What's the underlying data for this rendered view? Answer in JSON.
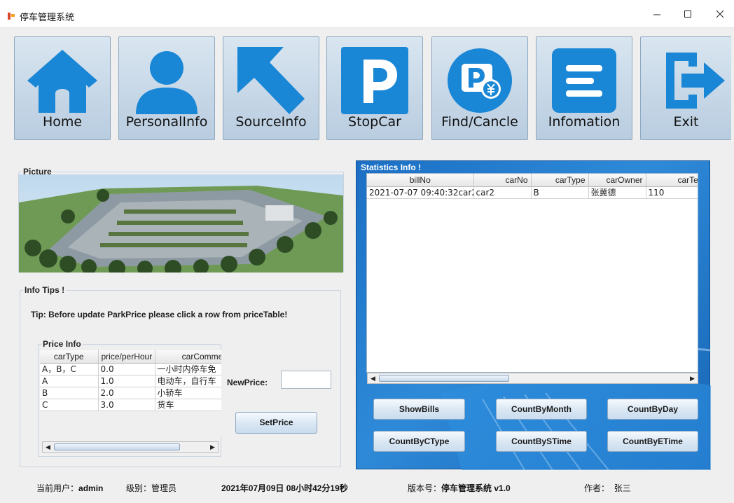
{
  "window": {
    "title": "停车管理系统"
  },
  "nav": [
    {
      "label": "Home",
      "icon": "home-icon"
    },
    {
      "label": "PersonalInfo",
      "icon": "person-icon"
    },
    {
      "label": "SourceInfo",
      "icon": "arrow-pointer-icon"
    },
    {
      "label": "StopCar",
      "icon": "parking-icon"
    },
    {
      "label": "Find/Cancle",
      "icon": "parking-payment-icon"
    },
    {
      "label": "Infomation",
      "icon": "list-icon"
    },
    {
      "label": "Exit",
      "icon": "exit-icon"
    }
  ],
  "picture": {
    "legend": "Picture"
  },
  "info_tips": {
    "legend": "Info Tips !",
    "tip": "Tip: Before update ParkPrice please click a row from priceTable!"
  },
  "price_info": {
    "legend": "Price Info",
    "columns": [
      "carType",
      "price/perHour",
      "carComme"
    ],
    "rows": [
      [
        "A，B，C",
        "0.0",
        "一小时内停车免"
      ],
      [
        "A",
        "1.0",
        "电动车，自行车"
      ],
      [
        "B",
        "2.0",
        "小轿车"
      ],
      [
        "C",
        "3.0",
        "货车"
      ]
    ],
    "new_price_label": "NewPrice:",
    "new_price_value": "",
    "set_price_button": "SetPrice"
  },
  "statistics": {
    "legend": "Statistics Info !",
    "columns": [
      "billNo",
      "carNo",
      "carType",
      "carOwner",
      "carTel"
    ],
    "rows": [
      [
        "2021-07-07 09:40:32car2",
        "car2",
        "B",
        "张冀德",
        "110"
      ]
    ],
    "buttons": [
      "ShowBills",
      "CountByMonth",
      "CountByDay",
      "CountByCType",
      "CountBySTime",
      "CountByETime"
    ]
  },
  "status_bar": {
    "user_label": "当前用户：",
    "user_value": "admin",
    "level_label": "级别：",
    "level_value": "管理员",
    "datetime": "2021年07月09日 08小时42分19秒",
    "version_label": "版本号：",
    "version_value": "停车管理系统 v1.0",
    "author_label": "作者：",
    "author_value": "张三"
  },
  "colors": {
    "icon_blue": "#1a86d6",
    "stats_panel_blue": "#1b6fc4",
    "nav_button_bg": "#c5d6e6"
  }
}
